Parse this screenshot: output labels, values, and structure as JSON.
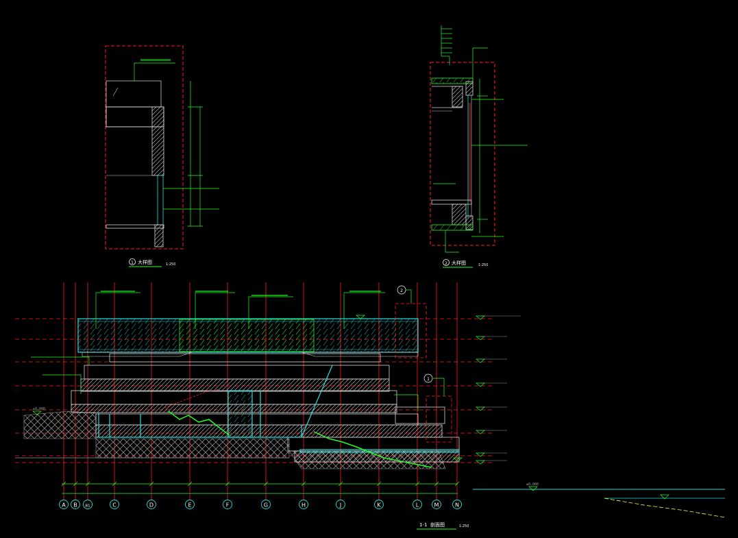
{
  "drawing": {
    "bg": "#000000",
    "colors": {
      "red": "#ff2020",
      "green": "#20ff20",
      "cyan": "#20e0e0",
      "white": "#ffffff",
      "yellow": "#ffff40",
      "grey": "#9a9a9a"
    },
    "detail_1": {
      "number": "1",
      "title": "大样图",
      "scale": "1:250"
    },
    "detail_2": {
      "number": "2",
      "title": "大样图",
      "scale": "1:250"
    },
    "section": {
      "number": "1-1",
      "title": "剖面图",
      "scale": "1:250"
    },
    "axes": [
      "A",
      "B",
      "B1",
      "C",
      "D",
      "E",
      "F",
      "G",
      "H",
      "J",
      "K",
      "L",
      "M",
      "N"
    ],
    "callouts": {
      "c2": "2",
      "c1": "1"
    },
    "site_levels": {
      "left": "±0.000",
      "right": "±0.000"
    }
  }
}
